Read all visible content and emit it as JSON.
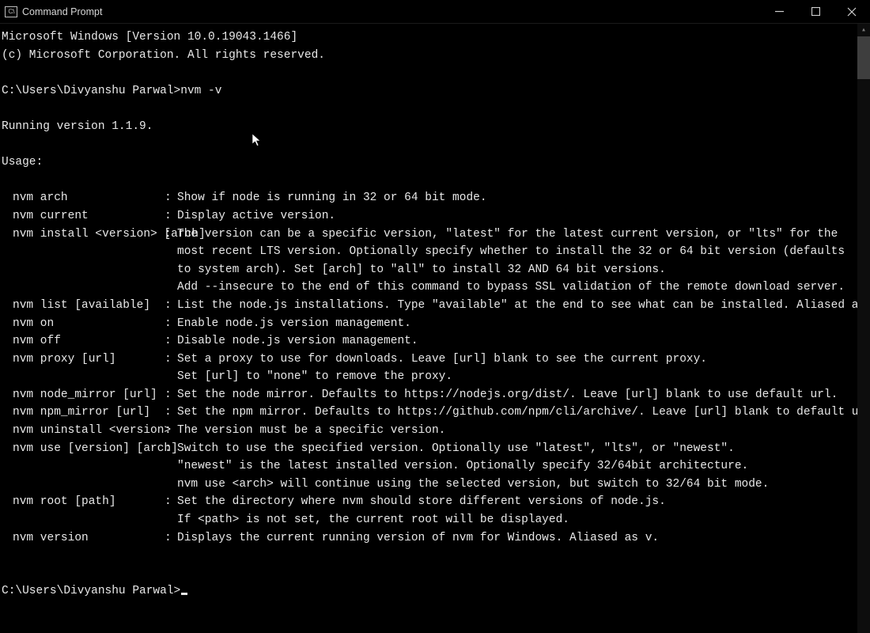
{
  "window": {
    "title": "Command Prompt",
    "icon_text": "C:\\"
  },
  "header": {
    "os_line": "Microsoft Windows [Version 10.0.19043.1466]",
    "copyright": "(c) Microsoft Corporation. All rights reserved."
  },
  "session": {
    "prompt": "C:\\Users\\Divyanshu Parwal>",
    "command": "nvm -v",
    "final_prompt": "C:\\Users\\Divyanshu Parwal>"
  },
  "output": {
    "running": "Running version 1.1.9.",
    "usage_label": "Usage:"
  },
  "commands": [
    {
      "cmd": "nvm arch",
      "desc": [
        "Show if node is running in 32 or 64 bit mode."
      ]
    },
    {
      "cmd": "nvm current",
      "desc": [
        "Display active version."
      ]
    },
    {
      "cmd": "nvm install <version> [arch]",
      "desc": [
        "The version can be a specific version, \"latest\" for the latest current version, or \"lts\" for the",
        "most recent LTS version. Optionally specify whether to install the 32 or 64 bit version (defaults",
        "to system arch). Set [arch] to \"all\" to install 32 AND 64 bit versions.",
        "Add --insecure to the end of this command to bypass SSL validation of the remote download server."
      ]
    },
    {
      "cmd": "nvm list [available]",
      "desc": [
        "List the node.js installations. Type \"available\" at the end to see what can be installed. Aliased as ls."
      ]
    },
    {
      "cmd": "nvm on",
      "desc": [
        "Enable node.js version management."
      ]
    },
    {
      "cmd": "nvm off",
      "desc": [
        "Disable node.js version management."
      ]
    },
    {
      "cmd": "nvm proxy [url]",
      "desc": [
        "Set a proxy to use for downloads. Leave [url] blank to see the current proxy.",
        "Set [url] to \"none\" to remove the proxy."
      ]
    },
    {
      "cmd": "nvm node_mirror [url]",
      "desc": [
        "Set the node mirror. Defaults to https://nodejs.org/dist/. Leave [url] blank to use default url."
      ]
    },
    {
      "cmd": "nvm npm_mirror [url]",
      "desc": [
        "Set the npm mirror. Defaults to https://github.com/npm/cli/archive/. Leave [url] blank to default url."
      ]
    },
    {
      "cmd": "nvm uninstall <version>",
      "desc": [
        "The version must be a specific version."
      ]
    },
    {
      "cmd": "nvm use [version] [arch]",
      "desc": [
        "Switch to use the specified version. Optionally use \"latest\", \"lts\", or \"newest\".",
        "\"newest\" is the latest installed version. Optionally specify 32/64bit architecture.",
        "nvm use <arch> will continue using the selected version, but switch to 32/64 bit mode."
      ]
    },
    {
      "cmd": "nvm root [path]",
      "desc": [
        "Set the directory where nvm should store different versions of node.js.",
        "If <path> is not set, the current root will be displayed."
      ]
    },
    {
      "cmd": "nvm version",
      "desc": [
        "Displays the current running version of nvm for Windows. Aliased as v."
      ]
    }
  ],
  "sep": ":"
}
